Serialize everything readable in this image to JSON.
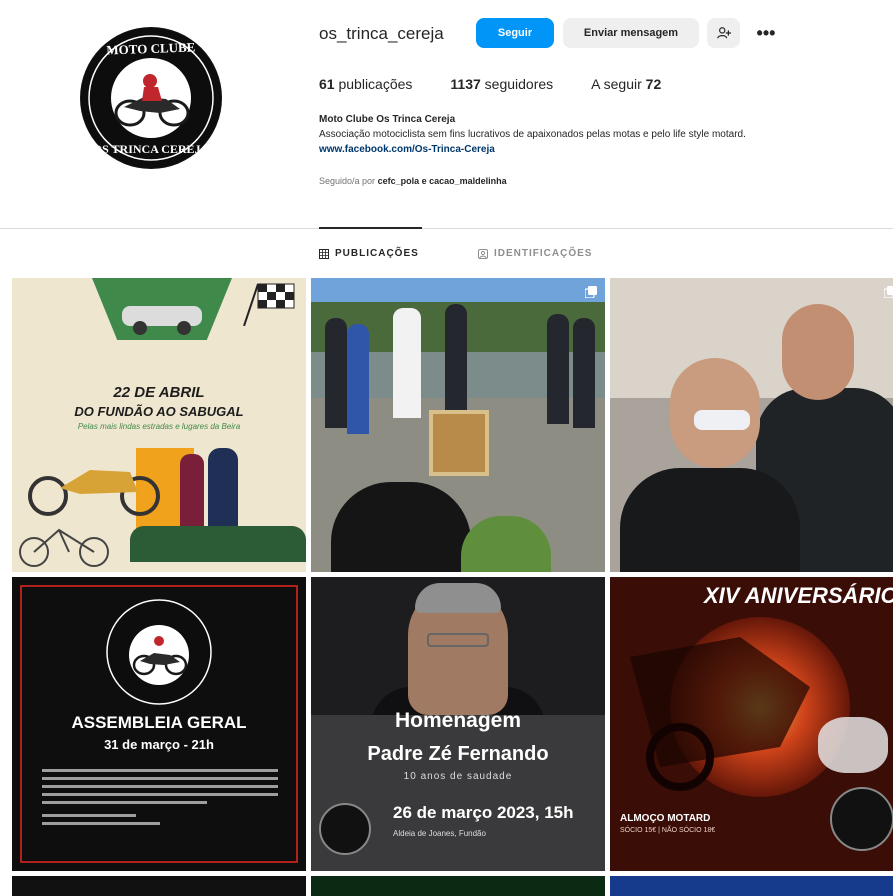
{
  "profile": {
    "username": "os_trinca_cereja",
    "follow_label": "Seguir",
    "message_label": "Enviar mensagem",
    "suggest_icon": "person-add-icon",
    "more_icon": "more-options-icon",
    "stats": {
      "posts_value": "61",
      "posts_label": "publicações",
      "followers_value": "1137",
      "followers_label": "seguidores",
      "following_label": "A seguir",
      "following_value": "72"
    },
    "bio": {
      "name": "Moto Clube Os Trinca Cereja",
      "description": "Associação motociclista sem fins lucrativos de apaixonados pelas motas e pelo life style motard.",
      "link": "www.facebook.com/Os-Trinca-Cereja"
    },
    "followed_by": {
      "prefix": "Seguido/a por",
      "names": "cefc_pola e cacao_maldelinha"
    }
  },
  "tabs": {
    "posts": "PUBLICAÇÕES",
    "tagged": "IDENTIFICAÇÕES"
  },
  "posts": {
    "p1": {
      "date": "22 DE ABRIL",
      "place": "DO FUNDÃO AO SABUGAL",
      "tagline": "Pelas mais lindas estradas e lugares da Beira"
    },
    "p4": {
      "title": "ASSEMBLEIA GERAL",
      "subtitle": "31 de março - 21h"
    },
    "p5": {
      "title": "Homenagem",
      "name": "Padre Zé Fernando",
      "subtitle": "10 anos de saudade",
      "when": "26 de março 2023, 15h",
      "where": "Aldeia de Joanes, Fundão"
    },
    "p6": {
      "heading": "XIV ANIVERSÁRIO",
      "footer": "ALMOÇO MOTARD",
      "footer_small": "SÓCIO 15€ | NÃO SÓCIO 18€"
    }
  },
  "colors": {
    "accent": "#0095f6",
    "text": "#262626",
    "muted": "#737373",
    "link": "#00376b"
  }
}
